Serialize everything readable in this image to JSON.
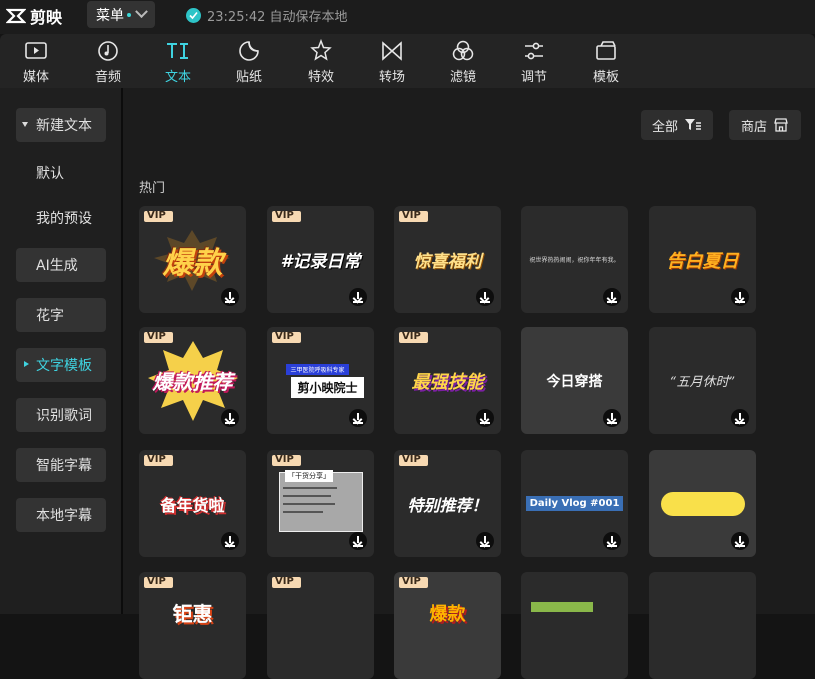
{
  "app": {
    "logo_text": "剪映",
    "menu_label": "菜单",
    "save_status": "23:25:42 自动保存本地"
  },
  "accent_color": "#3fd3e0",
  "toolbar": [
    {
      "label": "媒体",
      "icon": "media-icon"
    },
    {
      "label": "音频",
      "icon": "audio-icon"
    },
    {
      "label": "文本",
      "icon": "text-icon",
      "active": true
    },
    {
      "label": "贴纸",
      "icon": "sticker-icon"
    },
    {
      "label": "特效",
      "icon": "effects-icon"
    },
    {
      "label": "转场",
      "icon": "transition-icon"
    },
    {
      "label": "滤镜",
      "icon": "filter-icon"
    },
    {
      "label": "调节",
      "icon": "adjust-icon"
    },
    {
      "label": "模板",
      "icon": "template-icon"
    }
  ],
  "sidebar": [
    {
      "label": "新建文本"
    },
    {
      "label": "默认"
    },
    {
      "label": "我的预设"
    },
    {
      "label": "AI生成"
    },
    {
      "label": "花字"
    },
    {
      "label": "文字模板",
      "active": true
    },
    {
      "label": "识别歌词"
    },
    {
      "label": "智能字幕"
    },
    {
      "label": "本地字幕"
    }
  ],
  "filter_button": "全部",
  "store_button": "商店",
  "section": "热门",
  "vip_label": "VIP",
  "cards": [
    {
      "text": "爆款"
    },
    {
      "text": "#记录日常"
    },
    {
      "text": "惊喜福利"
    },
    {
      "text": "祝世界热热闹闹，祝你年年有我。"
    },
    {
      "text": "告白夏日"
    },
    {
      "text": "爆款推荐"
    },
    {
      "text": "三甲医院呼吸科专家",
      "text2": "剪小映院士"
    },
    {
      "text": "最强技能"
    },
    {
      "text": "今日穿搭"
    },
    {
      "text": "“五月休时”"
    },
    {
      "text": "备年货啦"
    },
    {
      "text": "「干货分享」"
    },
    {
      "text": "特别推荐！"
    },
    {
      "text": "Daily Vlog #001"
    },
    {
      "text": ""
    },
    {
      "text": "钜惠"
    },
    {
      "text": ""
    },
    {
      "text": "爆款"
    },
    {
      "text": ""
    },
    {
      "text": ""
    }
  ]
}
